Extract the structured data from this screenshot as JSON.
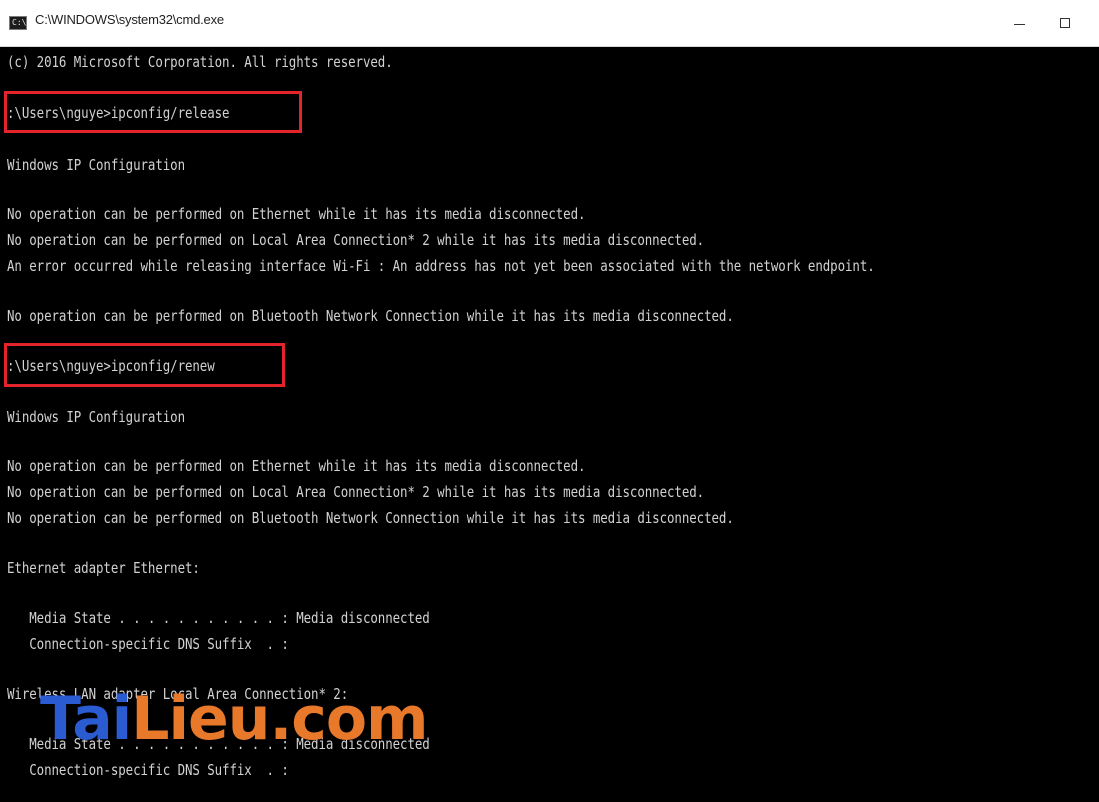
{
  "window": {
    "title": "C:\\WINDOWS\\system32\\cmd.exe",
    "icon": "cmd-icon",
    "icon_text": "C:\\",
    "controls": [
      "minimize",
      "maximize",
      "close"
    ],
    "close_glyph": "✕"
  },
  "console": {
    "lines": [
      "(c) 2016 Microsoft Corporation. All rights reserved.",
      ":\\Users\\nguye>ipconfig/release",
      "Windows IP Configuration",
      "No operation can be performed on Ethernet while it has its media disconnected.",
      "No operation can be performed on Local Area Connection* 2 while it has its media disconnected.",
      "An error occurred while releasing interface Wi-Fi : An address has not yet been associated with the network endpoint.",
      "No operation can be performed on Bluetooth Network Connection while it has its media disconnected.",
      ":\\Users\\nguye>ipconfig/renew",
      "Windows IP Configuration",
      "No operation can be performed on Ethernet while it has its media disconnected.",
      "No operation can be performed on Local Area Connection* 2 while it has its media disconnected.",
      "No operation can be performed on Bluetooth Network Connection while it has its media disconnected.",
      "Ethernet adapter Ethernet:",
      "   Media State . . . . . . . . . . . : Media disconnected",
      "   Connection-specific DNS Suffix  . :",
      "Wireless LAN adapter Local Area Connection* 2:",
      "   Media State . . . . . . . . . . . : Media disconnected",
      "   Connection-specific DNS Suffix  . :"
    ]
  },
  "watermark": {
    "part1": "Tai",
    "part2": "Lieu",
    "part3": ".com"
  },
  "colors": {
    "console_bg": "#000000",
    "console_text": "#d2d2d2",
    "highlight": "#e3242b",
    "watermark_blue": "#2a5bd0",
    "watermark_orange": "#e8782a"
  }
}
